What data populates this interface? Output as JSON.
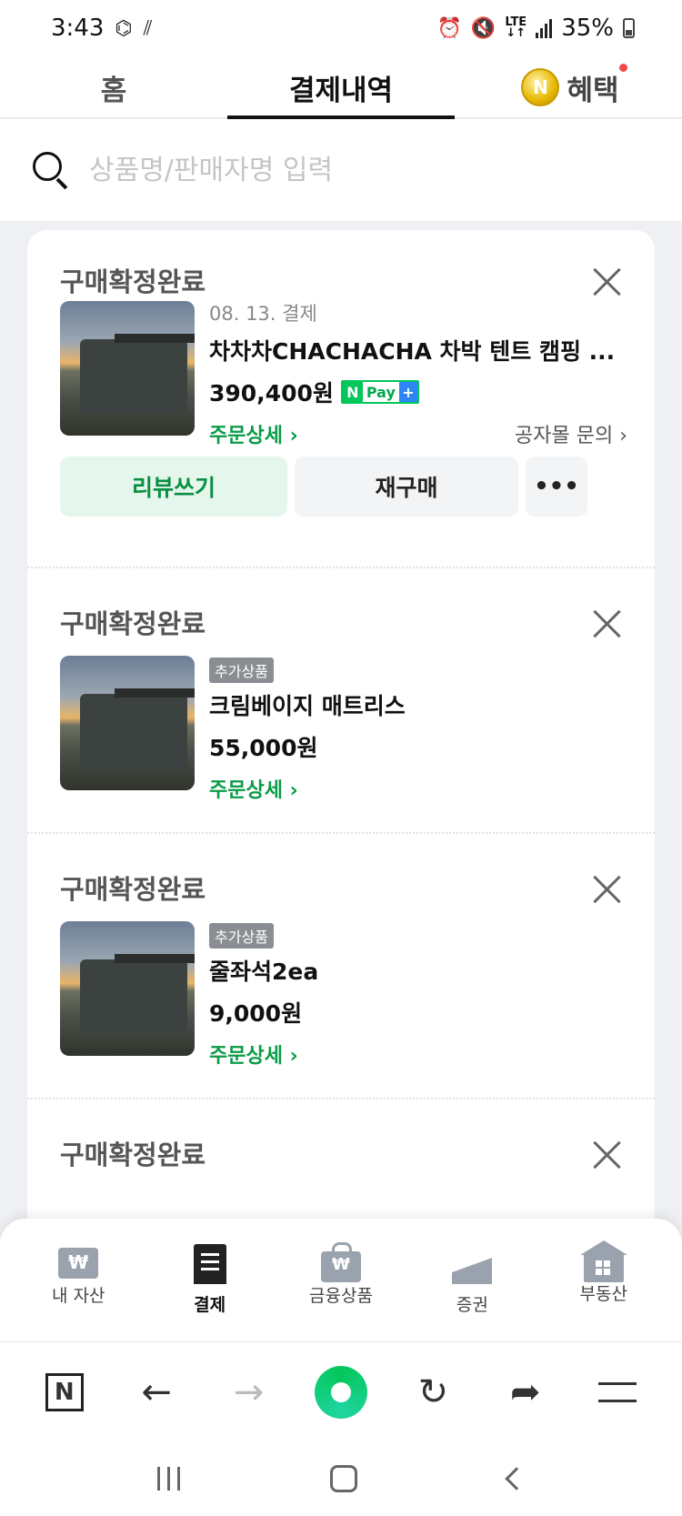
{
  "status_bar": {
    "time": "3:43",
    "network": "LTE",
    "battery": "35%"
  },
  "tabs": {
    "home": "홈",
    "payments": "결제내역",
    "benefits": "혜택",
    "coin_label": "N"
  },
  "search": {
    "placeholder": "상품명/판매자명 입력"
  },
  "orders": [
    {
      "status": "구매확정완료",
      "date": "08. 13. 결제",
      "name": "차차차CHACHACHA 차박 텐트 캠핑 ...",
      "price": "390,400원",
      "npay": {
        "n": "N",
        "pay": "Pay",
        "plus": "+"
      },
      "detail_link": "주문상세 ›",
      "inquiry_link": "공자몰 문의 ›",
      "buttons": {
        "review": "리뷰쓰기",
        "rebuy": "재구매",
        "more": "•••"
      }
    },
    {
      "status": "구매확정완료",
      "badge": "추가상품",
      "name": "크림베이지 매트리스",
      "price": "55,000원",
      "detail_link": "주문상세 ›"
    },
    {
      "status": "구매확정완료",
      "badge": "추가상품",
      "name": "줄좌석2ea",
      "price": "9,000원",
      "detail_link": "주문상세 ›"
    },
    {
      "status": "구매확정완료"
    }
  ],
  "bottom_nav": [
    {
      "label": "내 자산",
      "icon": "wallet-icon"
    },
    {
      "label": "결제",
      "icon": "receipt-icon",
      "active": true
    },
    {
      "label": "금융상품",
      "icon": "shopping-bag-icon"
    },
    {
      "label": "증권",
      "icon": "stock-chart-icon"
    },
    {
      "label": "부동산",
      "icon": "building-icon"
    }
  ],
  "browser_bar": {
    "n_button": "N"
  },
  "colors": {
    "accent_green": "#03c75a",
    "detail_green": "#0a9b47",
    "npay_blue": "#2d86f5"
  }
}
